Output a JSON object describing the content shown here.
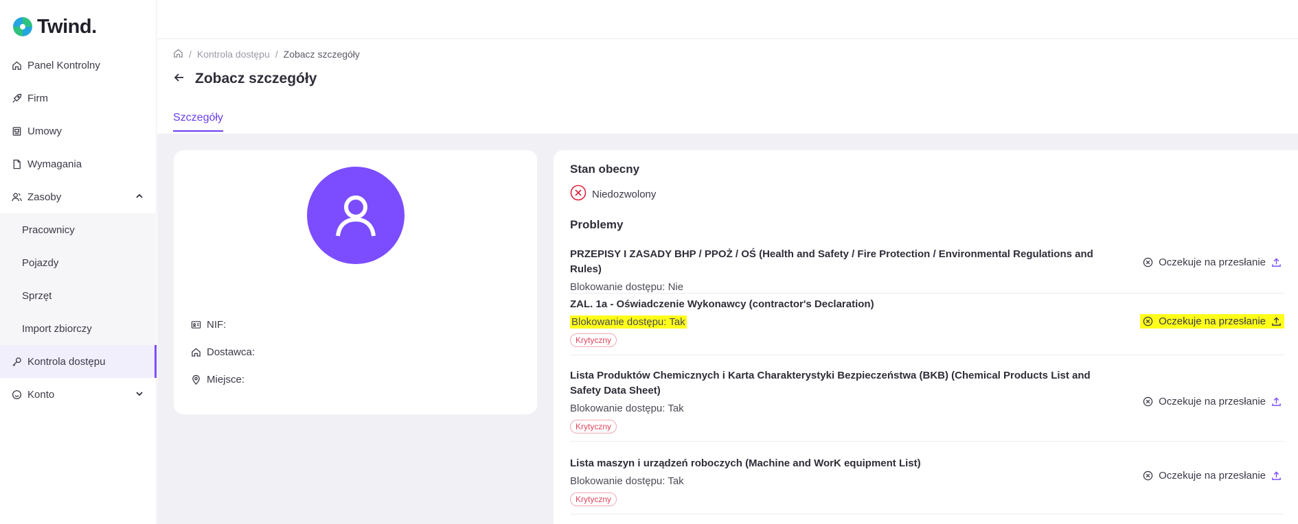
{
  "app": {
    "logo_text": "Twind."
  },
  "sidebar": {
    "items": [
      {
        "label": "Panel Kontrolny",
        "icon": "home-icon"
      },
      {
        "label": "Firm",
        "icon": "rocket-icon"
      },
      {
        "label": "Umowy",
        "icon": "contract-icon"
      },
      {
        "label": "Wymagania",
        "icon": "document-icon"
      },
      {
        "label": "Zasoby",
        "icon": "users-icon",
        "expanded": true
      },
      {
        "label": "Kontrola dostępu",
        "icon": "key-icon",
        "active": true
      },
      {
        "label": "Konto",
        "icon": "smile-icon"
      }
    ],
    "sub_items": [
      {
        "label": "Pracownicy"
      },
      {
        "label": "Pojazdy"
      },
      {
        "label": "Sprzęt"
      },
      {
        "label": "Import zbiorczy"
      }
    ]
  },
  "breadcrumb": {
    "items": [
      "Kontrola dostępu",
      "Zobacz szczegóły"
    ]
  },
  "page": {
    "title": "Zobacz szczegóły",
    "tab": "Szczegóły"
  },
  "details": {
    "nif_label": "NIF:",
    "supplier_label": "Dostawca:",
    "place_label": "Miejsce:"
  },
  "status": {
    "title": "Stan obecny",
    "value": "Niedozwolony",
    "color": "#e0203a"
  },
  "problems": {
    "title": "Problemy",
    "items": [
      {
        "title": "PRZEPISY I ZASADY BHP / PPOŻ / OŚ (Health and Safety / Fire Protection / Environmental Regulations and Rules)",
        "blocking": "Blokowanie dostępu: Nie",
        "badge": "",
        "status": "Oczekuje na przesłanie",
        "highlighted": false
      },
      {
        "title": "ZAL. 1a - Oświadczenie Wykonawcy (contractor's Declaration)",
        "blocking": "Blokowanie dostępu: Tak",
        "badge": "Krytyczny",
        "status": "Oczekuje na przesłanie",
        "highlighted": true
      },
      {
        "title": "Lista Produktów Chemicznych i Karta Charakterystyki Bezpieczeństwa (BKB) (Chemical Products List and Safety Data Sheet)",
        "blocking": "Blokowanie dostępu: Tak",
        "badge": "Krytyczny",
        "status": "Oczekuje na przesłanie",
        "highlighted": false
      },
      {
        "title": "Lista maszyn i urządzeń roboczych (Machine and WorK equipment List)",
        "blocking": "Blokowanie dostępu: Tak",
        "badge": "Krytyczny",
        "status": "Oczekuje na przesłanie",
        "highlighted": false
      }
    ]
  },
  "colors": {
    "accent": "#7b4dff",
    "highlight": "#ffff1a",
    "danger": "#e0203a",
    "badge_text": "#e0455f"
  }
}
